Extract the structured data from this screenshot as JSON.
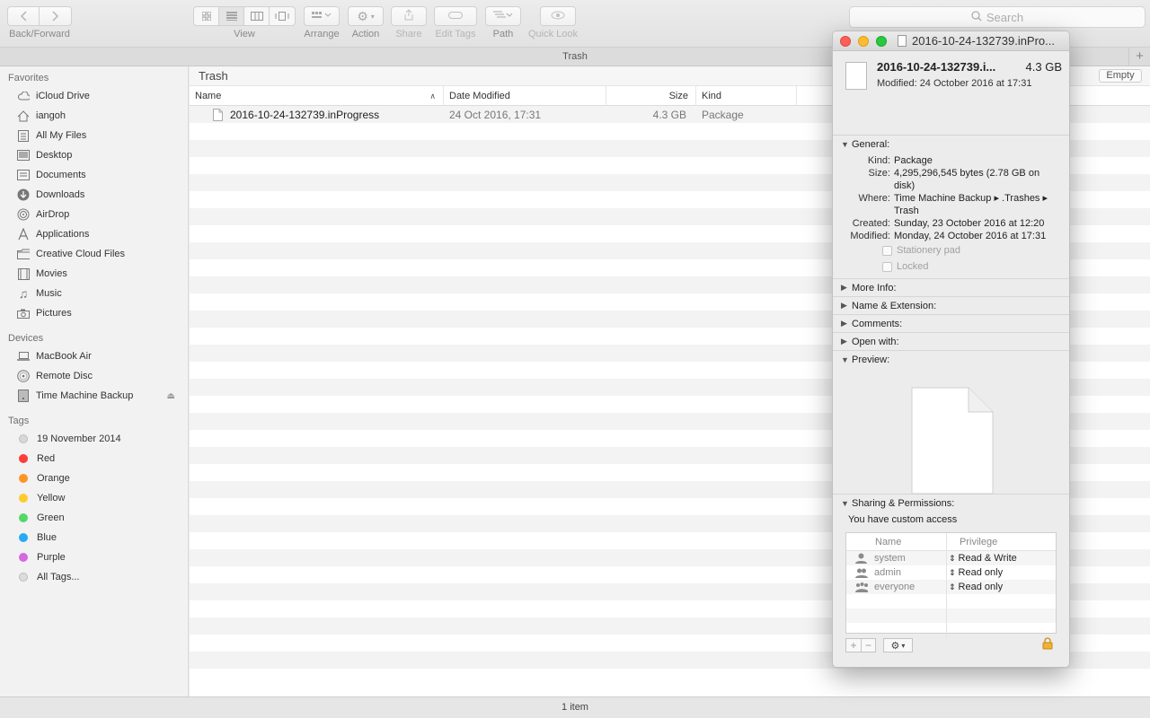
{
  "toolbar": {
    "back_forward_label": "Back/Forward",
    "view_label": "View",
    "arrange_label": "Arrange",
    "action_label": "Action",
    "share_label": "Share",
    "edit_tags_label": "Edit Tags",
    "path_label": "Path",
    "quick_look_label": "Quick Look",
    "search_placeholder": "Search"
  },
  "tabbar": {
    "title": "Trash"
  },
  "sidebar": {
    "favorites_header": "Favorites",
    "favorites": [
      {
        "label": "iCloud Drive",
        "icon": "cloud-icon"
      },
      {
        "label": "iangoh",
        "icon": "home-icon"
      },
      {
        "label": "All My Files",
        "icon": "all-files-icon"
      },
      {
        "label": "Desktop",
        "icon": "desktop-icon"
      },
      {
        "label": "Documents",
        "icon": "documents-icon"
      },
      {
        "label": "Downloads",
        "icon": "downloads-icon"
      },
      {
        "label": "AirDrop",
        "icon": "airdrop-icon"
      },
      {
        "label": "Applications",
        "icon": "applications-icon"
      },
      {
        "label": "Creative Cloud Files",
        "icon": "folder-icon"
      },
      {
        "label": "Movies",
        "icon": "movies-icon"
      },
      {
        "label": "Music",
        "icon": "music-icon"
      },
      {
        "label": "Pictures",
        "icon": "camera-icon"
      }
    ],
    "devices_header": "Devices",
    "devices": [
      {
        "label": "MacBook Air",
        "icon": "laptop-icon"
      },
      {
        "label": "Remote Disc",
        "icon": "disc-icon"
      },
      {
        "label": "Time Machine Backup",
        "icon": "drive-icon"
      }
    ],
    "tags_header": "Tags",
    "tags": [
      {
        "label": "19 November 2014",
        "color": "#d8d8d8"
      },
      {
        "label": "Red",
        "color": "#fc3d39"
      },
      {
        "label": "Orange",
        "color": "#fd9426"
      },
      {
        "label": "Yellow",
        "color": "#fecb2f"
      },
      {
        "label": "Green",
        "color": "#53d769"
      },
      {
        "label": "Blue",
        "color": "#25aaf5"
      },
      {
        "label": "Purple",
        "color": "#d36ae0"
      },
      {
        "label": "All Tags...",
        "color": "#cfcfcf"
      }
    ]
  },
  "main": {
    "path_title": "Trash",
    "empty_button": "Empty",
    "columns": {
      "name": "Name",
      "date": "Date Modified",
      "size": "Size",
      "kind": "Kind"
    },
    "files": [
      {
        "name": "2016-10-24-132739.inProgress",
        "date": "24 Oct 2016, 17:31",
        "size": "4.3 GB",
        "kind": "Package"
      }
    ]
  },
  "status": {
    "text": "1 item"
  },
  "info": {
    "window_title": "2016-10-24-132739.inPro...",
    "name": "2016-10-24-132739.i...",
    "size": "4.3 GB",
    "modified": "Modified: 24 October 2016 at 17:31",
    "general_header": "General:",
    "general": {
      "kind_label": "Kind:",
      "kind": "Package",
      "size_label": "Size:",
      "size": "4,295,296,545 bytes (2.78 GB on disk)",
      "where_label": "Where:",
      "where": "Time Machine Backup ▸ .Trashes ▸ Trash",
      "created_label": "Created:",
      "created": "Sunday, 23 October 2016 at 12:20",
      "modified_label": "Modified:",
      "modified": "Monday, 24 October 2016 at 17:31",
      "stationery": "Stationery pad",
      "locked": "Locked"
    },
    "more_info_header": "More Info:",
    "name_ext_header": "Name & Extension:",
    "comments_header": "Comments:",
    "open_with_header": "Open with:",
    "preview_header": "Preview:",
    "sharing_header": "Sharing & Permissions:",
    "sharing_note": "You have custom access",
    "perm_columns": {
      "name": "Name",
      "privilege": "Privilege"
    },
    "permissions": [
      {
        "user": "system",
        "privilege": "Read & Write"
      },
      {
        "user": "admin",
        "privilege": "Read only"
      },
      {
        "user": "everyone",
        "privilege": "Read only"
      }
    ]
  }
}
